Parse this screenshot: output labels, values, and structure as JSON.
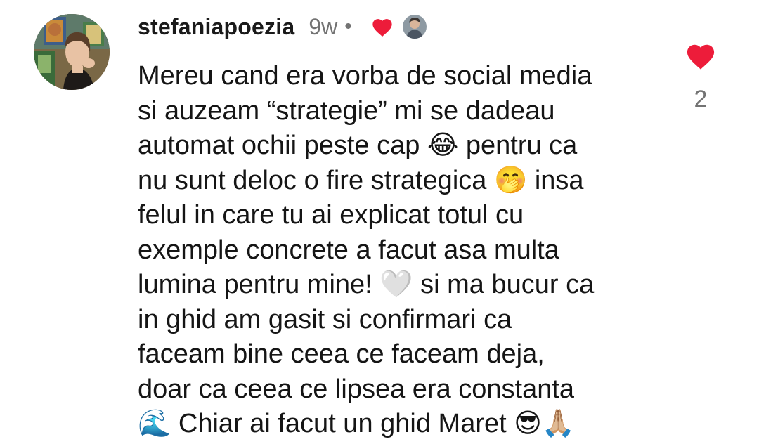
{
  "comment": {
    "username": "stefaniapoezia",
    "timestamp": "9w",
    "separator": "•",
    "body": "Mereu cand era vorba de social media\nsi auzeam “strategie” mi se dadeau\nautomat ochii peste cap 😂 pentru ca\nnu sunt deloc o fire strategica 🤭 insa\nfelul in care tu ai explicat totul cu\nexemple concrete a facut asa multa\nlumina pentru mine! 🤍 si ma bucur ca\nin ghid am gasit si confirmari ca\nfaceam bine ceea ce faceam deja,\ndoar ca ceea ce lipsea era constanta\n🌊 Chiar ai facut un ghid Maret 😎🙏🏼",
    "like_count": "2",
    "liked": true,
    "liked_by_author": true
  },
  "icons": {
    "like": "heart-icon",
    "author_like": "heart-icon"
  },
  "colors": {
    "heart": "#ed1c3a",
    "username": "#1a1a1a",
    "meta": "#737373",
    "text": "#151515",
    "background": "#ffffff"
  }
}
